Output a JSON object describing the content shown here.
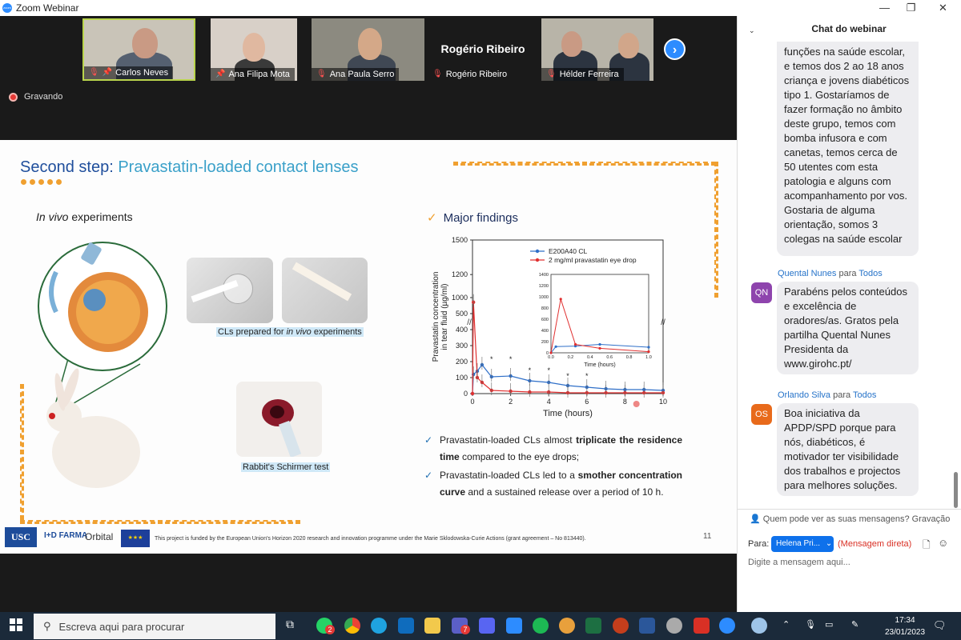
{
  "window": {
    "title": "Zoom Webinar"
  },
  "participants": [
    {
      "name": "Carlos Neves",
      "muted": true,
      "pinned": true
    },
    {
      "name": "Ana Filipa Mota",
      "muted": false,
      "pinned": true
    },
    {
      "name": "Ana Paula Serro",
      "muted": true,
      "pinned": false
    },
    {
      "name": "Rogério Ribeiro",
      "muted": true,
      "pinned": false,
      "display_name": "Rogério Ribeiro"
    },
    {
      "name": "Hélder Ferreira",
      "muted": true,
      "pinned": false
    }
  ],
  "recording_label": "Gravando",
  "slide": {
    "title_prefix": "Second step:",
    "title_highlight": "Pravastatin-loaded contact lenses",
    "invivo_italic": "In vivo",
    "invivo_rest": " experiments",
    "major_findings": "Major findings",
    "caption1_a": "CLs prepared for ",
    "caption1_i": "in vivo",
    "caption1_b": " experiments",
    "caption2": "Rabbit's Schirmer test",
    "finding1_a": "Pravastatin-loaded CLs almost ",
    "finding1_b": "triplicate the residence time",
    "finding1_c": " compared to the eye drops;",
    "finding2_a": "Pravastatin-loaded CLs led to a ",
    "finding2_b": "smother concentration curve",
    "finding2_c": " and a sustained release over a period of 10 h.",
    "funding": "This project is funded by the European Union's Horizon 2020 research and innovation programme under the Marie Sklodowska-Curie Actions (grant agreement – No 813440).",
    "slide_number": "11",
    "logos": [
      "USC",
      "FARMA",
      "Orbital"
    ]
  },
  "chart_data": {
    "type": "line",
    "xlabel": "Time (hours)",
    "ylabel": "Pravastatin concentration in tear fluid (µg/ml)",
    "xlim": [
      0,
      10
    ],
    "ylim": [
      0,
      1500
    ],
    "xticks": [
      "0",
      "2",
      "4",
      "6",
      "8",
      "10"
    ],
    "yticks": [
      "0",
      "100",
      "200",
      "300",
      "400",
      "500",
      "1000",
      "1200",
      "1500"
    ],
    "y_axis_break": true,
    "series": [
      {
        "name": "E200A40 CL",
        "color": "#2f6fc8",
        "x": [
          0,
          0.05,
          0.25,
          0.5,
          1,
          2,
          3,
          4,
          5,
          6,
          7,
          8,
          9,
          10
        ],
        "y": [
          0,
          120,
          140,
          180,
          105,
          110,
          80,
          70,
          50,
          40,
          30,
          25,
          25,
          20
        ]
      },
      {
        "name": "2 mg/ml pravastatin eye drop",
        "color": "#e03030",
        "x": [
          0,
          0.05,
          0.25,
          0.5,
          1,
          2,
          3,
          4,
          5,
          6,
          7,
          8,
          9,
          10
        ],
        "y": [
          0,
          960,
          100,
          70,
          20,
          15,
          10,
          10,
          5,
          5,
          5,
          5,
          5,
          5
        ]
      }
    ],
    "significance_x": [
      1,
      2,
      3,
      4,
      5,
      6
    ],
    "inset": {
      "xlabel": "Time (hours)",
      "xlim": [
        0,
        1.0
      ],
      "ylim": [
        0,
        1400
      ],
      "xticks": [
        "0.0",
        "0.2",
        "0.4",
        "0.6",
        "0.8",
        "1.0"
      ],
      "yticks": [
        "0",
        "200",
        "400",
        "600",
        "800",
        "1000",
        "1200",
        "1400"
      ],
      "series": [
        {
          "name": "E200A40 CL",
          "color": "#2f6fc8",
          "x": [
            0,
            0.05,
            0.25,
            0.5,
            1.0
          ],
          "y": [
            0,
            110,
            120,
            150,
            100
          ]
        },
        {
          "name": "2 mg/ml pravastatin eye drop",
          "color": "#e03030",
          "x": [
            0,
            0.1,
            0.25,
            0.5,
            1.0
          ],
          "y": [
            0,
            960,
            150,
            80,
            20
          ]
        }
      ]
    },
    "legend_position": "top"
  },
  "chat": {
    "title": "Chat do webinar",
    "messages": [
      {
        "sender": "",
        "to": "",
        "initials": "",
        "text": "funções na saúde escolar, e temos dos 2 ao 18 anos criança e jovens diabéticos tipo 1. Gostaríamos de fazer formação no âmbito deste grupo, temos com bomba infusora e com canetas, temos cerca de 50 utentes com esta patologia e alguns com acompanhamento por vos. Gostaria de alguma orientação, somos 3 colegas na saúde escolar"
      },
      {
        "sender": "Quental Nunes",
        "to": "Todos",
        "connector": "para",
        "initials": "QN",
        "avatar_color": "#8e44ad",
        "text": "Parabéns pelos conteúdos e excelência de oradores/as. Gratos pela partilha Quental Nunes Presidenta da www.girohc.pt/"
      },
      {
        "sender": "Orlando Silva",
        "to": "Todos",
        "connector": "para",
        "initials": "OS",
        "avatar_color": "#e86a1b",
        "text": "Boa iniciativa da APDP/SPD porque para nós, diabéticos, é motivador ter visibilidade dos trabalhos e projectos para melhores soluções."
      }
    ],
    "who_can_see": "Quem pode ver as suas mensagens? Gravação li...",
    "to_label": "Para:",
    "recipient": "Helena Pri...",
    "direct_label": "(Mensagem direta)",
    "input_placeholder": "Digite a mensagem aqui..."
  },
  "taskbar": {
    "search_placeholder": "Escreva aqui para procurar",
    "time": "17:34",
    "date": "23/01/2023",
    "whatsapp_badge": "2",
    "teams_badge": "7"
  }
}
